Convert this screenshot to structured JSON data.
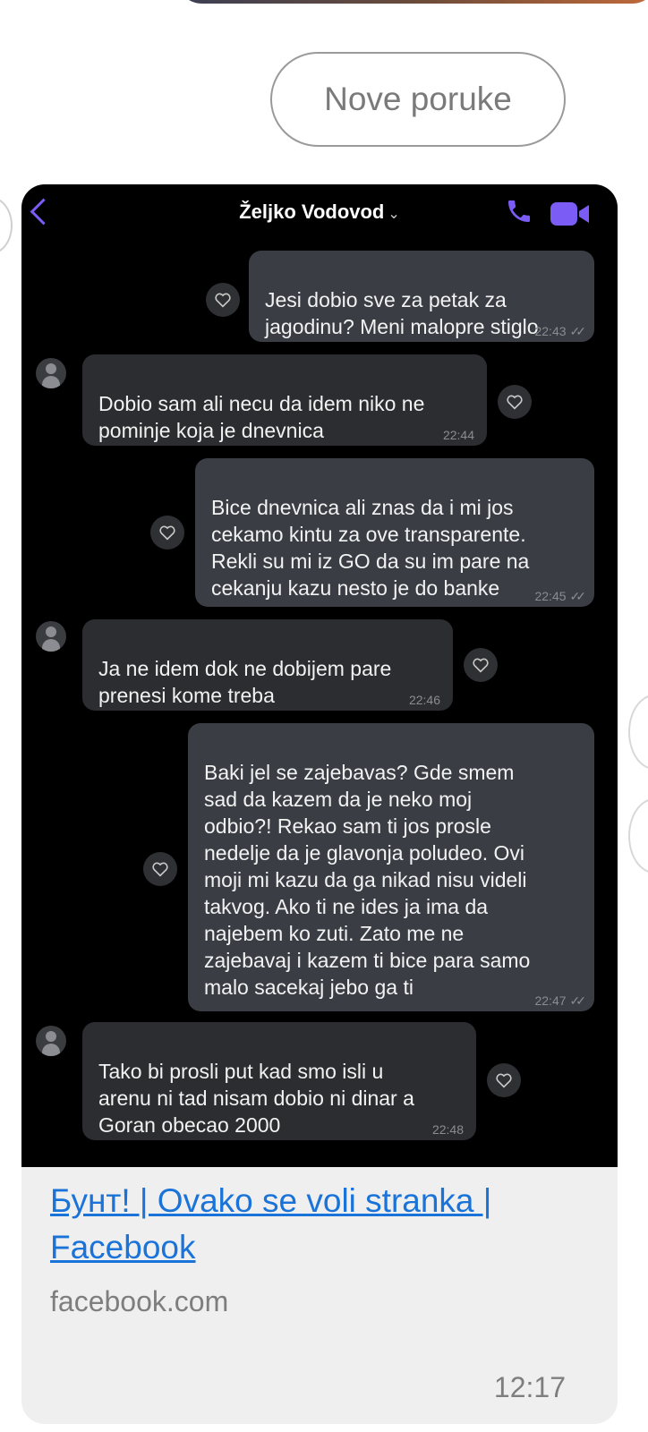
{
  "new_messages_label": "Nove poruke",
  "chat": {
    "contact_name": "Željko Vodovod",
    "chevron": "⌄",
    "messages": [
      {
        "dir": "out",
        "text": "Jesi dobio sve za petak za\njagodinu? Meni malopre stiglo",
        "time": "22:43",
        "read": true
      },
      {
        "dir": "in",
        "text": "Dobio sam ali necu da idem niko ne\npominje koja je dnevnica",
        "time": "22:44",
        "read": false
      },
      {
        "dir": "out",
        "text": "Bice dnevnica ali znas da i mi jos\ncekamo kintu za ove transparente.\nRekli su mi iz GO da su im pare na\ncekanju kazu nesto je do banke",
        "time": "22:45",
        "read": true
      },
      {
        "dir": "in",
        "text": "Ja ne idem dok ne dobijem pare\nprenesi kome treba",
        "time": "22:46",
        "read": false
      },
      {
        "dir": "out",
        "text": "Baki jel se zajebavas? Gde smem\nsad da kazem da je neko moj\nodbio?! Rekao sam ti jos prosle\nnedelje da je glavonja poludeo. Ovi\nmoji mi kazu da ga nikad nisu videli\ntakvog. Ako ti ne ides ja ima da\nnajebem ko zuti. Zato me ne\nzajebavaj i kazem ti bice para samo\nmalo sacekaj jebo ga ti",
        "time": "22:47",
        "read": true
      },
      {
        "dir": "in",
        "text": "Tako bi prosli put kad smo isli u\narenu ni tad nisam dobio ni dinar a\nGoran obecao 2000",
        "time": "22:48",
        "read": false
      }
    ]
  },
  "link_preview": {
    "title": "Бунт! | Ovako se voli stranka | Facebook",
    "domain": "facebook.com",
    "time": "12:17"
  },
  "icons": {
    "back": "back-chevron-icon",
    "call": "phone-icon",
    "video": "video-camera-icon",
    "react": "heart-icon",
    "read": "double-check-icon",
    "avatar": "user-avatar-icon"
  },
  "colors": {
    "accent": "#7b5cf5",
    "link": "#1a73d9",
    "outgoing_bubble": "#3a3d44",
    "incoming_bubble": "#2c2d30"
  }
}
